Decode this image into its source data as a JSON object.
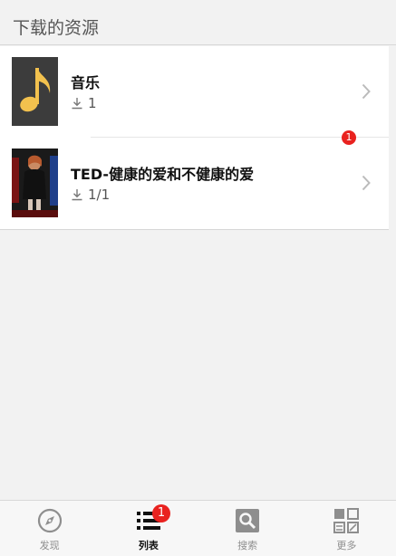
{
  "header": {
    "title": "下载的资源"
  },
  "items": [
    {
      "title": "音乐",
      "count": "1"
    },
    {
      "title": "TED-健康的爱和不健康的爱",
      "count": "1/1",
      "badge": "1"
    }
  ],
  "tabs": [
    {
      "label": "发现",
      "icon": "compass-icon"
    },
    {
      "label": "列表",
      "icon": "list-icon",
      "badge": "1"
    },
    {
      "label": "搜索",
      "icon": "search-icon"
    },
    {
      "label": "更多",
      "icon": "grid-more-icon"
    }
  ],
  "colors": {
    "badge": "#e9221f",
    "music_note": "#f2c14e"
  }
}
